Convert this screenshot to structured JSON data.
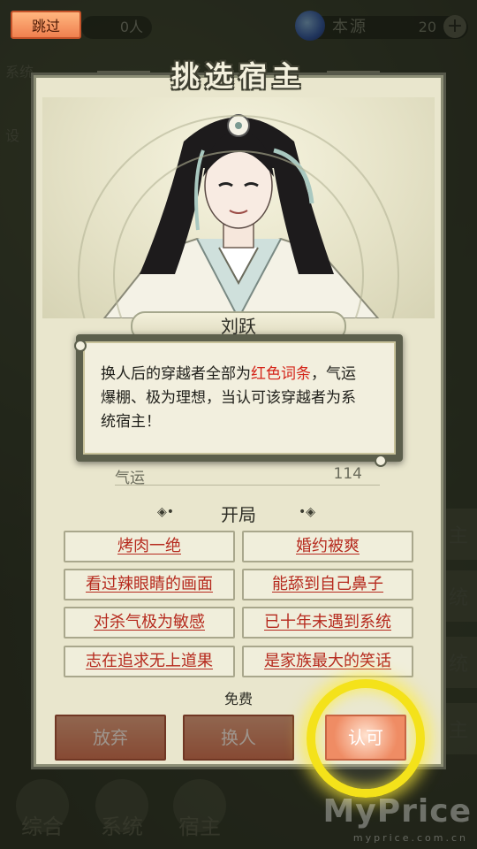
{
  "topbar": {
    "skip_label": "跳过",
    "people_count": "0人",
    "source_label": "本源",
    "source_value": "20",
    "plus_symbol": "+"
  },
  "dialog": {
    "title": "挑选宿主",
    "host_name": "刘跃",
    "luck_label": "气运",
    "luck_value": "114",
    "start_heading": "开局",
    "traits": [
      "烤肉一绝",
      "婚约被爽",
      "看过辣眼睛的画面",
      "能舔到自己鼻子",
      "对杀气极为敏感",
      "已十年未遇到系统",
      "志在追求无上道果",
      "是家族最大的笑话"
    ],
    "free_label": "免费",
    "buttons": {
      "abandon": "放弃",
      "swap": "换人",
      "confirm": "认可"
    }
  },
  "tooltip": {
    "text_before": "换人后的穿越者全部为",
    "text_highlight": "红色词条",
    "text_after": "，气运爆棚、极为理想，当认可该穿越者为系统宿主！"
  },
  "bottom_nav": [
    "综合",
    "系统",
    "宿主"
  ],
  "watermark": {
    "main": "MyPrice",
    "sub": "myprice.com.cn"
  },
  "colors": {
    "trait_red": "#b62a1e",
    "highlight_red": "#d42318",
    "ring_yellow": "#f4e21a",
    "button_orange": "#d97753"
  }
}
